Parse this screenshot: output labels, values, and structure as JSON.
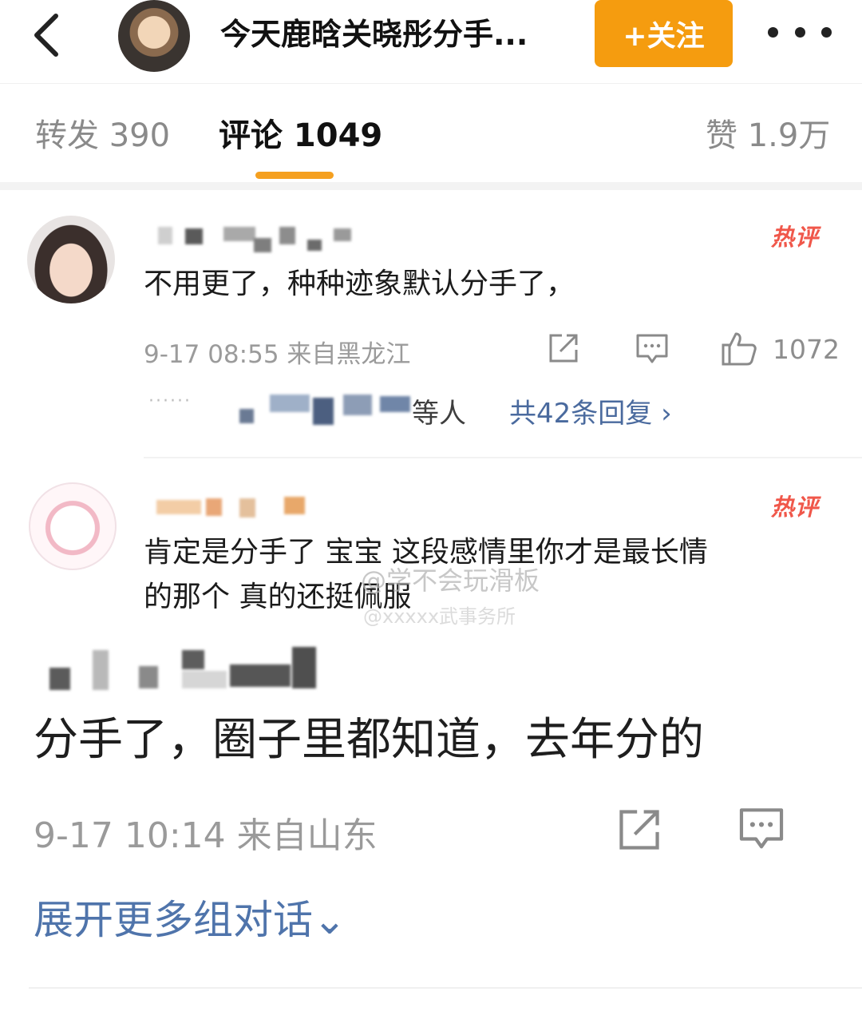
{
  "header": {
    "title": "今天鹿晗关晓彤分手...",
    "follow_label": "+关注"
  },
  "tabs": {
    "repost": "转发 390",
    "comment": "评论 1049",
    "like": "赞 1.9万"
  },
  "comments": [
    {
      "text": "不用更了，种种迹象默认分手了，",
      "badge": "热评",
      "meta": "9-17 08:55 来自黑龙江",
      "likes": "1072",
      "reply_tail": "等人",
      "reply_link": "共42条回复 ›",
      "reply_dots": "······"
    },
    {
      "text_line1": "肯定是分手了 宝宝 这段感情里你才是最长情",
      "text_line2": "的那个 真的还挺佩服",
      "badge": "热评"
    },
    {
      "text": "分手了，圈子里都知道，去年分的",
      "meta": "9-17 10:14 来自山东"
    }
  ],
  "watermark": {
    "line1": "@学不会玩滑板",
    "line2": "@xxxxx武事务所"
  },
  "expand_label": "展开更多组对话⌄",
  "colors": {
    "accent_orange": "#f59c0f",
    "hot_red": "#f0574a",
    "link_blue": "#4a6a9e"
  }
}
